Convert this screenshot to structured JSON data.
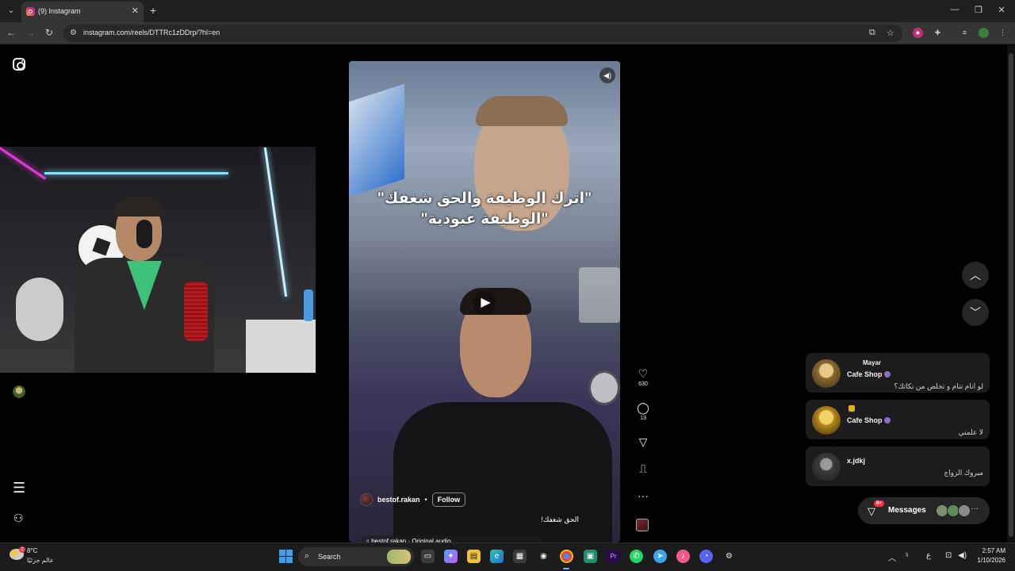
{
  "browser": {
    "tab_title": "(9) Instagram",
    "tab_close": "✕",
    "new_tab": "+",
    "url": "instagram.com/reels/DTTRc1zDDrp/?hl=en",
    "window_controls": {
      "minimize": "—",
      "restore": "❐",
      "close": "✕"
    }
  },
  "instagram": {
    "reel": {
      "caption_line1": "\"اترك الوظيفة والحق شغفك\"",
      "caption_line2": "\"الوظيفة عبودية\"",
      "username": "bestof.rakan",
      "dot": "•",
      "follow_label": "Follow",
      "description": "الحق شغفك!",
      "audio": "♫ bestof.rakan · Original audio"
    },
    "actions": {
      "likes": "630",
      "comments": "13"
    },
    "messages": [
      {
        "sender": "Mayar",
        "group": "Cafe Shop",
        "text": "لو انام تنام و تخلص من نكاتك؟"
      },
      {
        "group": "Cafe Shop",
        "text": "لا علمني"
      },
      {
        "sender": "x.jdkj",
        "text": "مبروك الزواج"
      }
    ],
    "messages_pill": {
      "label": "Messages",
      "badge": "9+",
      "more": "···"
    }
  },
  "taskbar": {
    "weather_temp": "8°C",
    "weather_desc": "عالم جزئيًا",
    "weather_badge": "2",
    "search_label": "Search",
    "language": "ع",
    "time": "2:57 AM",
    "date": "1/10/2026"
  },
  "colors": {
    "ig_background": "#000000",
    "browser_chrome": "#353535",
    "accent_blue": "#3aa0f0",
    "notification_red": "#ff3040"
  }
}
